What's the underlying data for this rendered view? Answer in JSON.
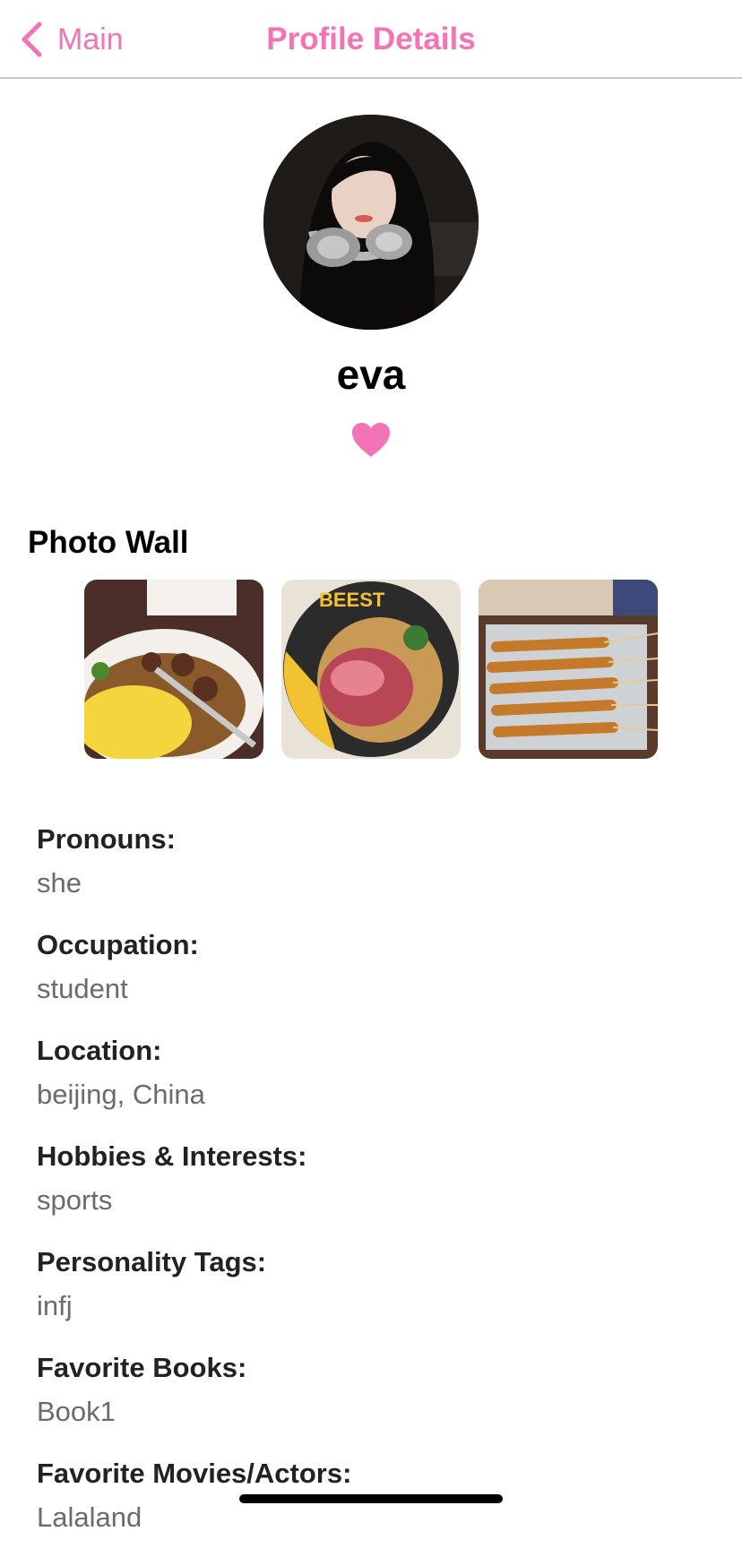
{
  "nav": {
    "back_label": "Main",
    "title": "Profile Details"
  },
  "profile": {
    "name": "eva",
    "liked": true
  },
  "photo_wall": {
    "title": "Photo Wall",
    "photos": [
      {
        "subject": "omelette rice with beef stew"
      },
      {
        "subject": "BEEST roast beef rice bowl",
        "text": "BEEST"
      },
      {
        "subject": "grilled skewers on tray"
      }
    ]
  },
  "fields": [
    {
      "label": "Pronouns:",
      "value": "she"
    },
    {
      "label": "Occupation:",
      "value": "student"
    },
    {
      "label": "Location:",
      "value": "beijing, China"
    },
    {
      "label": "Hobbies & Interests:",
      "value": "sports"
    },
    {
      "label": "Personality Tags:",
      "value": "infj"
    },
    {
      "label": "Favorite Books:",
      "value": "Book1"
    },
    {
      "label": "Favorite Movies/Actors:",
      "value": "Lalaland"
    }
  ],
  "colors": {
    "accent": "#f472b6",
    "label": "#222222",
    "value": "#6b6b6b",
    "divider": "#c8c8cc"
  },
  "icons": {
    "back": "chevron-left-icon",
    "like": "heart-icon"
  }
}
